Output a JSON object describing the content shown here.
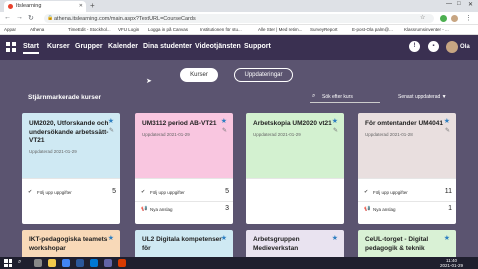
{
  "browser": {
    "tab_title": "Itslearning",
    "address": "athena.itslearning.com/main.aspx?TextURL=CourseCards",
    "bookmarks": [
      "Appar",
      "Athena",
      "TimeEdit - Stockhol...",
      "VFU Login",
      "Logga in på Canvas",
      "Institutionen för stu...",
      "Alle Ster | Med retim...",
      "SurveyReport",
      "E-post-Ola palm@...",
      "Klassrumsinventer - ..."
    ]
  },
  "nav": {
    "items": [
      "Start",
      "Kurser",
      "Grupper",
      "Kalender",
      "Dina studenter",
      "Videotjänsten",
      "Support"
    ],
    "user_name": "Ola"
  },
  "main": {
    "toggle_courses": "Kurser",
    "toggle_updates": "Uppdateringar",
    "section_title": "Stjärnmarkerade kurser",
    "search_placeholder": "Sök efter kurs",
    "sort_label": "Senast uppdaterad ▼"
  },
  "cards": [
    {
      "title": "UM2020, Utforskande och undersökande arbetssätt-VT21",
      "updated": "Uppdaterad 2021-01-29",
      "color": "#cfe9f3",
      "rows": [
        {
          "label": "Följ upp uppgifter",
          "count": "5"
        }
      ]
    },
    {
      "title": "UM3112 period AB-VT21",
      "updated": "Uppdaterad 2021-01-29",
      "color": "#f9c6e0",
      "rows": [
        {
          "label": "Följ upp uppgifter",
          "count": "5"
        },
        {
          "label": "Nya anslag",
          "count": "3"
        }
      ]
    },
    {
      "title": "Arbetskopia UM2020 vt21",
      "updated": "Uppdaterad 2021-01-29",
      "color": "#d3f1d0",
      "rows": []
    },
    {
      "title": "För omtentander UM4041",
      "updated": "Uppdaterad 2021-01-28",
      "color": "#e9dfdf",
      "rows": [
        {
          "label": "Följ upp uppgifter",
          "count": "11"
        },
        {
          "label": "Nya anslag",
          "count": "1"
        }
      ]
    }
  ],
  "cards_row2": [
    {
      "title": "IKT-pedagogiska teamets workshopar",
      "color": "#f8d9b8"
    },
    {
      "title": "UL2 Digitala kompetenser för",
      "color": "#cfe9f3"
    },
    {
      "title": "Arbetsgruppen Medieverkstan",
      "color": "#e9e3f0"
    },
    {
      "title": "CeUL-torget - Digital pedagogik & teknik",
      "color": "#d9f1d5"
    }
  ],
  "taskbar": {
    "time": "11:40",
    "date": "2021-01-29"
  }
}
